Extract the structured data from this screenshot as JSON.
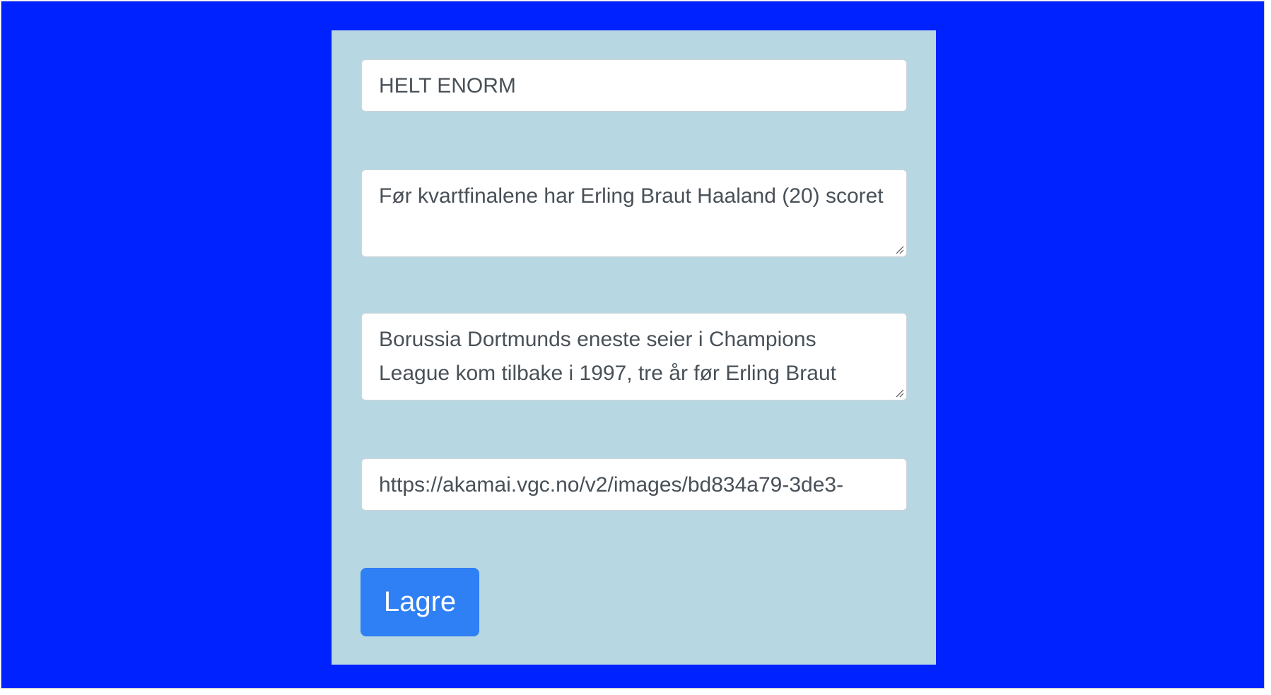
{
  "form": {
    "title_value": "HELT ENORM",
    "lead_value": "Før kvartfinalene har Erling Braut Haaland (20) scoret",
    "body_value": "Borussia Dortmunds eneste seier i Champions League kom tilbake i 1997, tre år før Erling Braut",
    "image_url_value": "https://akamai.vgc.no/v2/images/bd834a79-3de3-",
    "save_label": "Lagre"
  },
  "colors": {
    "page_background": "#0022ff",
    "card_background": "#b7d8e2",
    "button": "#2f7ff5"
  }
}
